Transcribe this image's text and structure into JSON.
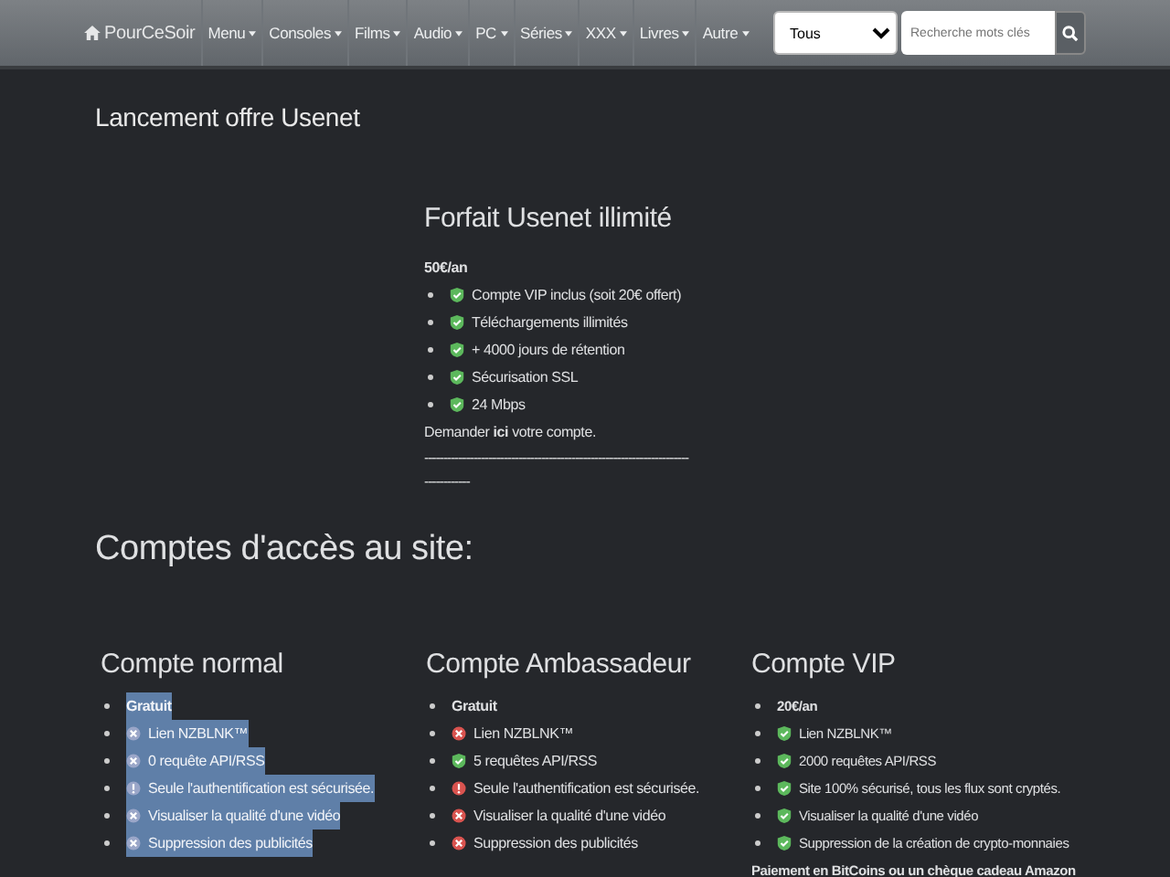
{
  "navbar": {
    "brand": "PourCeSoir",
    "menus": [
      "Menu",
      "Consoles",
      "Films",
      "Audio",
      "PC",
      "Séries",
      "XXX",
      "Livres",
      "Autre"
    ],
    "category_select": "Tous",
    "search": {
      "placeholder": "Recherche mots clés"
    }
  },
  "page_title": "Lancement offre Usenet",
  "offer": {
    "title": "Forfait Usenet illimité",
    "price": "50€/an",
    "features": [
      {
        "kind": "check",
        "text": "Compte VIP inclus (soit 20€ offert)"
      },
      {
        "kind": "check",
        "text": "Téléchargements illimités"
      },
      {
        "kind": "check",
        "text": "+ 4000 jours de rétention"
      },
      {
        "kind": "check",
        "text": "Sécurisation SSL"
      },
      {
        "kind": "check",
        "text": "24 Mbps"
      }
    ],
    "request": "Demander **ici** votre compte.",
    "rules": [
      "----------------------------------------------------------------------",
      "------------"
    ]
  },
  "accounts_title": "Comptes d'accès au site:",
  "accounts": [
    {
      "title": "Compte normal",
      "selected": true,
      "items": [
        {
          "kind": "plain",
          "text": "Gratuit"
        },
        {
          "kind": "cross",
          "text": "Lien NZBLNK™"
        },
        {
          "kind": "cross",
          "text": "0 requête API/RSS"
        },
        {
          "kind": "warn",
          "text": "Seule l'authentification est sécurisée."
        },
        {
          "kind": "cross",
          "text": "Visualiser la qualité d'une vidéo"
        },
        {
          "kind": "cross",
          "text": "Suppression des publicités"
        }
      ]
    },
    {
      "title": "Compte Ambassadeur",
      "selected": false,
      "items": [
        {
          "kind": "plain",
          "text": "Gratuit"
        },
        {
          "kind": "cross",
          "text": "Lien NZBLNK™"
        },
        {
          "kind": "check",
          "text": "5 requêtes API/RSS"
        },
        {
          "kind": "warn",
          "text": "Seule l'authentification est sécurisée."
        },
        {
          "kind": "cross",
          "text": "Visualiser la qualité d'une vidéo"
        },
        {
          "kind": "cross",
          "text": "Suppression des publicités"
        }
      ]
    },
    {
      "title": "Compte VIP",
      "selected": false,
      "items": [
        {
          "kind": "plain",
          "text": "20€/an"
        },
        {
          "kind": "check",
          "text": "Lien NZBLNK™"
        },
        {
          "kind": "check",
          "text": "2000 requêtes API/RSS"
        },
        {
          "kind": "check",
          "text": "Site 100% sécurisé, tous les flux sont cryptés."
        },
        {
          "kind": "check",
          "text": "Visualiser la qualité d'une vidéo"
        },
        {
          "kind": "check",
          "text": "Suppression de la création de crypto-monnaies"
        }
      ],
      "note": "Paiement en BitCoins ou un chèque cadeau Amazon"
    }
  ]
}
